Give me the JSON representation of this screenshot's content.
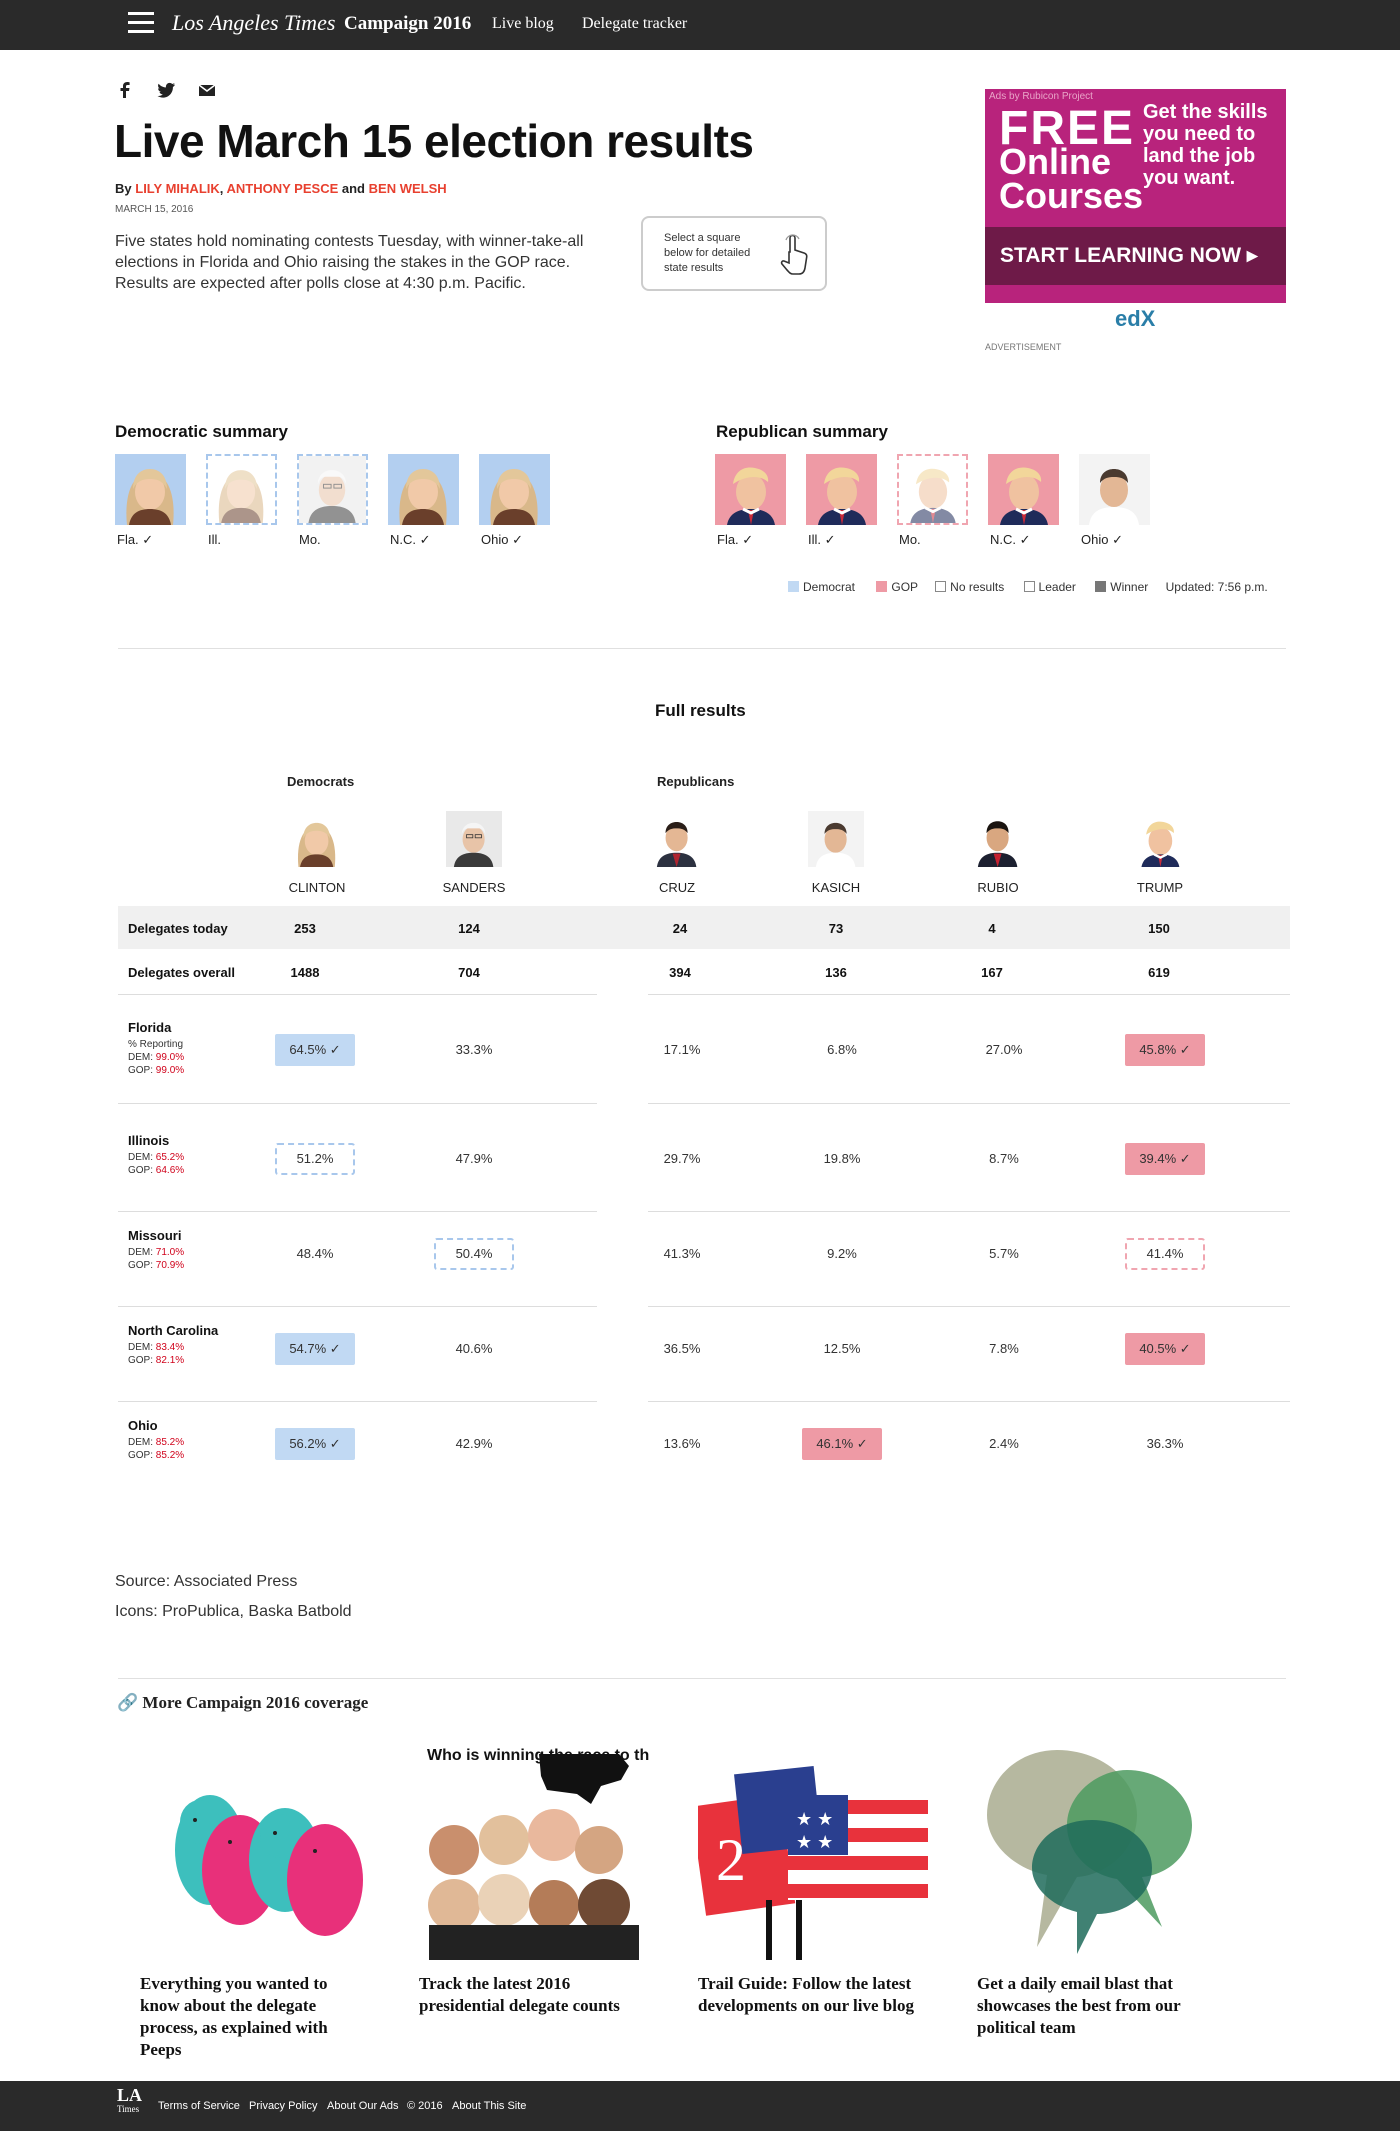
{
  "nav": {
    "logo": "Los Angeles Times",
    "campaign": "Campaign 2016",
    "live_blog": "Live blog",
    "delegate_tracker": "Delegate tracker"
  },
  "share": {
    "facebook": "facebook-icon",
    "twitter": "twitter-icon",
    "email": "email-icon"
  },
  "article": {
    "title": "Live March 15 election results",
    "by": "By",
    "author1": "LILY MIHALIK",
    "sep1": ",",
    "author2": "ANTHONY PESCE",
    "and": "and",
    "author3": "BEN WELSH",
    "date": "MARCH 15, 2016",
    "intro": "Five states hold nominating contests Tuesday, with winner-take-all elections in Florida and Ohio raising the stakes in the GOP race. Results are expected after polls close at 4:30 p.m. Pacific.",
    "hint_line1": "Select a square",
    "hint_line2": "below for detailed",
    "hint_line3": "state results"
  },
  "ad": {
    "by": "Ads by Rubicon Project",
    "free": "FREE",
    "online": "Online Courses",
    "skills": "Get the skills you need to land the job you want.",
    "cta": "START LEARNING NOW ▸",
    "brand": "edX",
    "label": "ADVERTISEMENT"
  },
  "summary": {
    "dem_title": "Democratic summary",
    "gop_title": "Republican summary",
    "dem": [
      {
        "label": "Fla. ✓",
        "style": "dem",
        "who": "clinton"
      },
      {
        "label": "Ill.",
        "style": "dashdem",
        "who": "clinton"
      },
      {
        "label": "Mo.",
        "style": "dashdem",
        "who": "sanders"
      },
      {
        "label": "N.C. ✓",
        "style": "dem",
        "who": "clinton"
      },
      {
        "label": "Ohio ✓",
        "style": "dem",
        "who": "clinton"
      }
    ],
    "gop": [
      {
        "label": "Fla. ✓",
        "style": "gop",
        "who": "trump"
      },
      {
        "label": "Ill. ✓",
        "style": "gop",
        "who": "trump"
      },
      {
        "label": "Mo.",
        "style": "dashgop",
        "who": "trump"
      },
      {
        "label": "N.C. ✓",
        "style": "gop",
        "who": "trump"
      },
      {
        "label": "Ohio ✓",
        "style": "gop",
        "who": "kasich"
      }
    ],
    "legend": {
      "democrat": "Democrat",
      "gop": "GOP",
      "no_results": "No results",
      "leader": "Leader",
      "winner": "Winner",
      "updated": "Updated: 7:56 p.m."
    }
  },
  "colors": {
    "dem": "#b3cff0",
    "gop": "#ee9aa5",
    "winner": "#777777",
    "accent": "#e8402f",
    "dark": "#2a2a2a"
  },
  "results": {
    "title": "Full results",
    "democrats": "Democrats",
    "republicans": "Republicans",
    "candidates": [
      "CLINTON",
      "SANDERS",
      "CRUZ",
      "KASICH",
      "RUBIO",
      "TRUMP"
    ],
    "delegates_today_label": "Delegates today",
    "delegates_today": [
      "253",
      "124",
      "24",
      "73",
      "4",
      "150"
    ],
    "delegates_overall_label": "Delegates overall",
    "delegates_overall": [
      "1488",
      "704",
      "394",
      "136",
      "167",
      "619"
    ],
    "states": [
      {
        "name": "Florida",
        "reporting": "% Reporting",
        "dem_label": "DEM:",
        "dem": "99.0%",
        "gop_label": "GOP:",
        "gop": "99.0%",
        "vals": [
          "64.5% ✓",
          "33.3%",
          "17.1%",
          "6.8%",
          "27.0%",
          "45.8% ✓"
        ],
        "styles": [
          "wd",
          "",
          "",
          "",
          "",
          "wg"
        ]
      },
      {
        "name": "Illinois",
        "reporting": "",
        "dem_label": "DEM:",
        "dem": "65.2%",
        "gop_label": "GOP:",
        "gop": "64.6%",
        "vals": [
          "51.2%",
          "47.9%",
          "29.7%",
          "19.8%",
          "8.7%",
          "39.4% ✓"
        ],
        "styles": [
          "ld",
          "",
          "",
          "",
          "",
          "wg"
        ]
      },
      {
        "name": "Missouri",
        "reporting": "",
        "dem_label": "DEM:",
        "dem": "71.0%",
        "gop_label": "GOP:",
        "gop": "70.9%",
        "vals": [
          "48.4%",
          "50.4%",
          "41.3%",
          "9.2%",
          "5.7%",
          "41.4%"
        ],
        "styles": [
          "",
          "ld",
          "",
          "",
          "",
          "lg"
        ]
      },
      {
        "name": "North Carolina",
        "reporting": "",
        "dem_label": "DEM:",
        "dem": "83.4%",
        "gop_label": "GOP:",
        "gop": "82.1%",
        "vals": [
          "54.7% ✓",
          "40.6%",
          "36.5%",
          "12.5%",
          "7.8%",
          "40.5% ✓"
        ],
        "styles": [
          "wd",
          "",
          "",
          "",
          "",
          "wg"
        ]
      },
      {
        "name": "Ohio",
        "reporting": "",
        "dem_label": "DEM:",
        "dem": "85.2%",
        "gop_label": "GOP:",
        "gop": "85.2%",
        "vals": [
          "56.2% ✓",
          "42.9%",
          "13.6%",
          "46.1% ✓",
          "2.4%",
          "36.3%"
        ],
        "styles": [
          "wd",
          "",
          "",
          "wg",
          "",
          ""
        ]
      }
    ]
  },
  "credits": {
    "source": "Source: Associated Press",
    "icons": "Icons: ProPublica, Baska Batbold"
  },
  "more": {
    "title": "More Campaign 2016 coverage",
    "cards": [
      {
        "caption": "Everything you wanted to know about the delegate process, as explained with Peeps"
      },
      {
        "caption": "Track the latest 2016 presidential delegate counts",
        "art": "Who is winning the race to the nomination?"
      },
      {
        "caption": "Trail Guide: Follow the latest developments on our live blog",
        "art": "2"
      },
      {
        "caption": "Get a daily email blast that showcases the best from our political team"
      }
    ]
  },
  "footer": {
    "logo_top": "LA",
    "logo_bottom": "Times",
    "terms": "Terms of Service",
    "privacy": "Privacy Policy",
    "ads": "About Our Ads",
    "copy": "© 2016",
    "about": "About This Site"
  }
}
